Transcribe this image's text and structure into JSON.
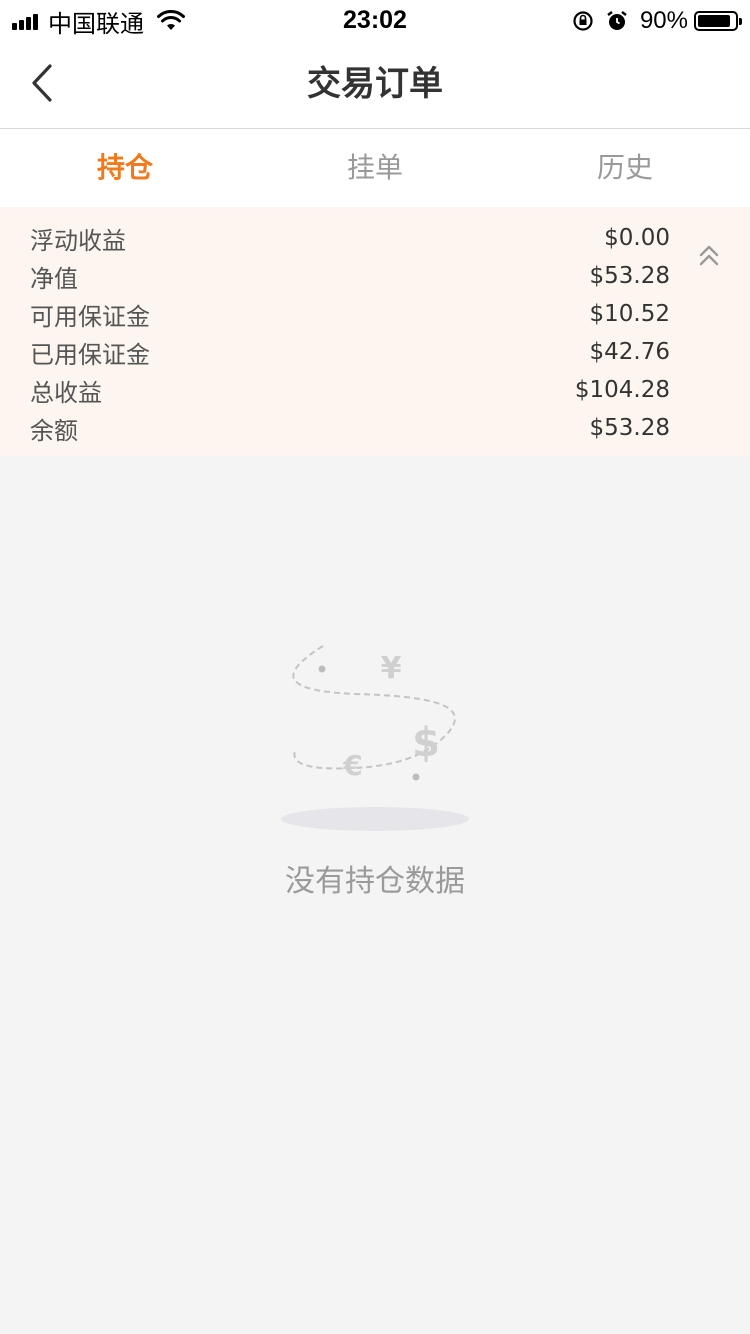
{
  "status_bar": {
    "carrier": "中国联通",
    "time": "23:02",
    "battery_percent": "90%",
    "battery_level": 0.9
  },
  "nav": {
    "title": "交易订单",
    "back_icon": "chevron-left-icon"
  },
  "tabs": [
    {
      "label": "持仓",
      "active": true
    },
    {
      "label": "挂单",
      "active": false
    },
    {
      "label": "历史",
      "active": false
    }
  ],
  "summary": {
    "rows": [
      {
        "label": "浮动收益",
        "value": "$0.00"
      },
      {
        "label": "净值",
        "value": "$53.28"
      },
      {
        "label": "可用保证金",
        "value": "$10.52"
      },
      {
        "label": "已用保证金",
        "value": "$42.76"
      },
      {
        "label": "总收益",
        "value": "$104.28"
      },
      {
        "label": "余额",
        "value": "$53.28"
      }
    ],
    "collapse_icon": "double-chevron-up-icon"
  },
  "empty_state": {
    "message": "没有持仓数据",
    "illustration_icon": "currency-empty-icon"
  },
  "colors": {
    "accent": "#f07b1e",
    "summary_bg": "#fdf6f0",
    "page_bg": "#f4f4f4",
    "muted_text": "#9a9a9a"
  }
}
